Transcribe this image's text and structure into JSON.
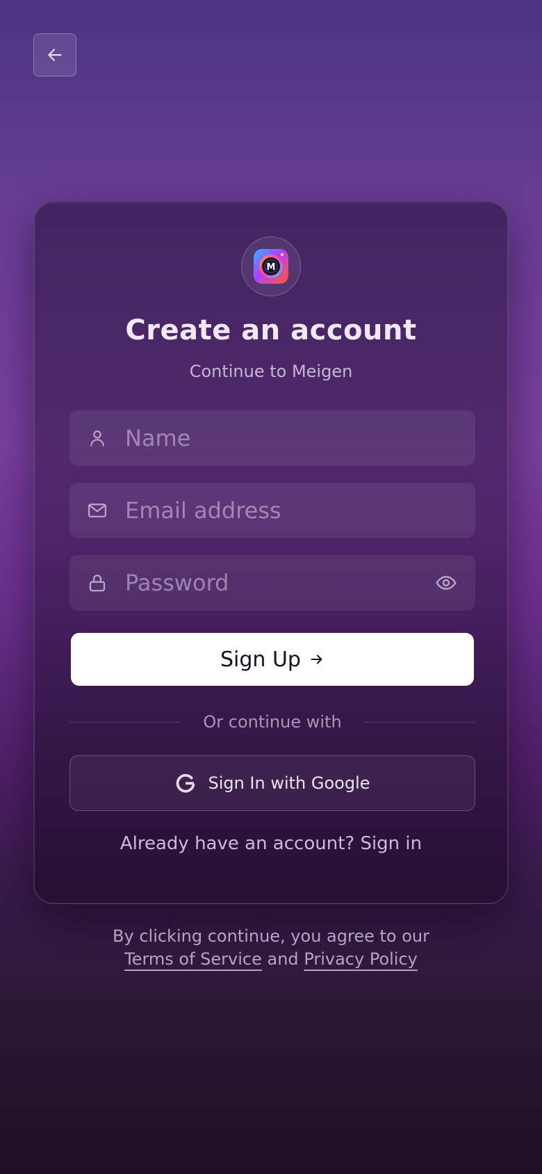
{
  "header": {
    "back_button_icon": "arrow-left-icon"
  },
  "card": {
    "logo_icon": "meigen-app-logo",
    "title": "Create an account",
    "subtitle": "Continue to Meigen",
    "fields": {
      "name": {
        "placeholder": "Name",
        "value": "",
        "icon": "user-icon"
      },
      "email": {
        "placeholder": "Email address",
        "value": "",
        "icon": "mail-icon"
      },
      "password": {
        "placeholder": "Password",
        "value": "",
        "icon": "lock-icon",
        "toggle_icon": "eye-icon"
      }
    },
    "signup_label": "Sign Up",
    "divider_text": "Or continue with",
    "google_label": "Sign In with Google",
    "signin_prompt": "Already have an account?",
    "signin_link": "Sign in"
  },
  "legal": {
    "prefix": "By clicking continue, you agree to our",
    "terms_link": "Terms of Service",
    "and_text": "and",
    "privacy_link": "Privacy Policy"
  },
  "colors": {
    "background_top": "#4a3482",
    "background_mid": "#7a3f9e",
    "background_bottom": "#1d0f24",
    "primary_button": "#ffffff",
    "primary_button_text": "#1a1020"
  }
}
